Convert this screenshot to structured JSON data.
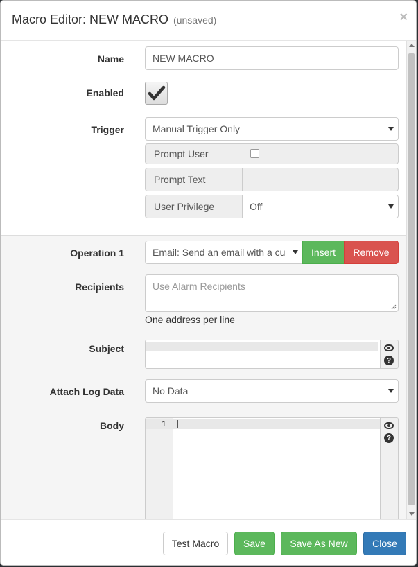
{
  "dialog": {
    "title": "Macro Editor: NEW MACRO",
    "status": "(unsaved)",
    "close_symbol": "×"
  },
  "form": {
    "name": {
      "label": "Name",
      "value": "NEW MACRO"
    },
    "enabled": {
      "label": "Enabled",
      "checked": true
    },
    "trigger": {
      "label": "Trigger",
      "selected": "Manual Trigger Only",
      "prompt_user_label": "Prompt User",
      "prompt_user_checked": false,
      "prompt_text_label": "Prompt Text",
      "prompt_text_value": "",
      "user_privilege_label": "User Privilege",
      "user_privilege_selected": "Off"
    },
    "operation": {
      "label": "Operation 1",
      "selected": "Email: Send an email with a cu",
      "insert_label": "Insert",
      "remove_label": "Remove"
    },
    "recipients": {
      "label": "Recipients",
      "placeholder": "Use Alarm Recipients",
      "help": "One address per line"
    },
    "subject": {
      "label": "Subject"
    },
    "attach_log": {
      "label": "Attach Log Data",
      "selected": "No Data"
    },
    "body": {
      "label": "Body",
      "line_number": "1"
    }
  },
  "footer": {
    "test_label": "Test Macro",
    "save_label": "Save",
    "save_as_new_label": "Save As New",
    "close_label": "Close"
  },
  "icons": {
    "preview": "eye-icon",
    "help": "question-circle-icon",
    "checkmark": "check-icon"
  },
  "colors": {
    "success": "#5cb85c",
    "danger": "#d9534f",
    "primary": "#337ab7"
  }
}
